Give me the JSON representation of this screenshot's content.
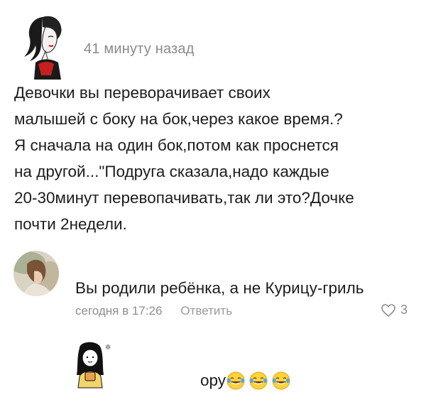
{
  "post": {
    "avatar_icon": "woman-portrait-sketch-icon",
    "time": "41 минуту назад",
    "text": "Девочки вы переворачивает своих\nмалышей с боку на бок,через какое время.?\nЯ сначала на один бок,потом как проснется\nна другой...\"Подруга сказала,надо каждые\n20-30минут перевопачивать,так ли это?Дочке\nпочти 2недели."
  },
  "reply": {
    "avatar_icon": "user-photo-avatar",
    "text": "Вы родили ребёнка, а не Курицу-гриль",
    "date": "сегодня в 17:26",
    "action": "Ответить",
    "like_icon": "heart-outline-icon",
    "like_count": "3"
  },
  "comment": {
    "avatar_icon": "cartoon-girl-with-cup-icon",
    "text": "ору",
    "emoji": [
      "laughing-tears-emoji",
      "laughing-tears-emoji",
      "laughing-tears-emoji"
    ]
  }
}
